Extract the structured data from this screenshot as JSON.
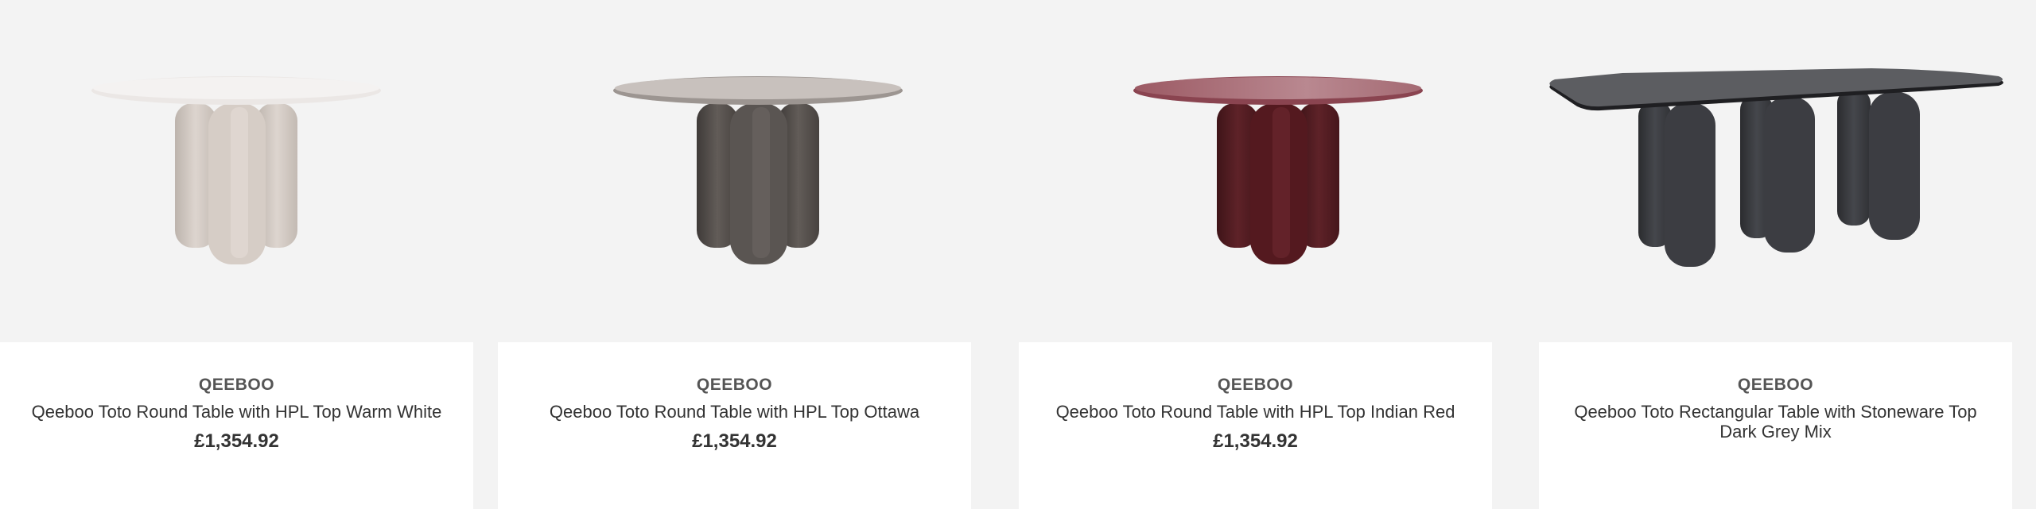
{
  "colors": {
    "page_background": "#f3f3f3",
    "card_info_background": "#ffffff",
    "warm_white": "#d8d0ca",
    "ottawa": "#5a5552",
    "indian_red": "#5a1f25",
    "dark_grey_mix": "#3a3b3f"
  },
  "products": [
    {
      "brand": "QEEBOO",
      "title": "Qeeboo Toto Round Table with HPL Top Warm White",
      "price": "£1,354.92",
      "image_icon": "round-table-warm-white"
    },
    {
      "brand": "QEEBOO",
      "title": "Qeeboo Toto Round Table with HPL Top Ottawa",
      "price": "£1,354.92",
      "image_icon": "round-table-ottawa"
    },
    {
      "brand": "QEEBOO",
      "title": "Qeeboo Toto Round Table with HPL Top Indian Red",
      "price": "£1,354.92",
      "image_icon": "round-table-indian-red"
    },
    {
      "brand": "QEEBOO",
      "title": "Qeeboo Toto Rectangular Table with Stoneware Top Dark Grey Mix",
      "price": "",
      "image_icon": "rectangular-table-dark-grey-mix"
    }
  ]
}
